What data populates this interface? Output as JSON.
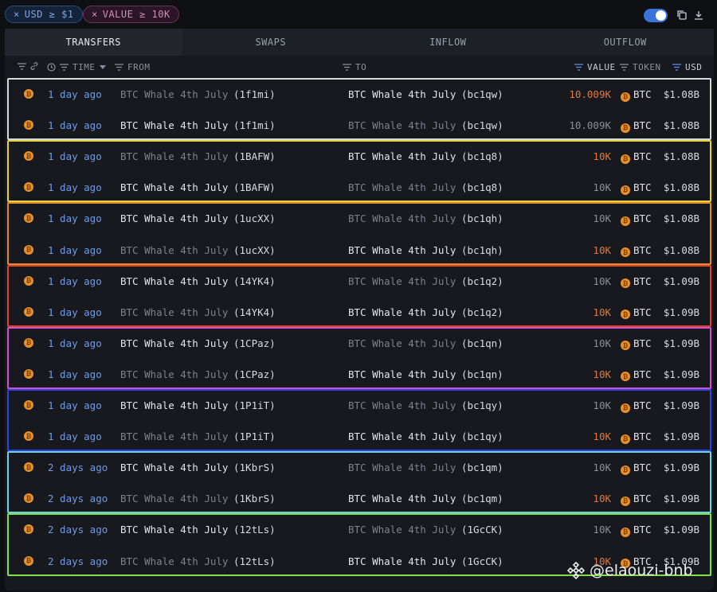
{
  "filters": [
    {
      "label": "USD ≥ $1",
      "remove_glyph": "×"
    },
    {
      "label": "VALUE ≥ 10K",
      "remove_glyph": "×"
    }
  ],
  "toolbar": {
    "toggle_state": "on",
    "icons": [
      "copy-icon",
      "download-icon"
    ]
  },
  "tabs": [
    {
      "label": "TRANSFERS",
      "active": true
    },
    {
      "label": "SWAPS",
      "active": false
    },
    {
      "label": "INFLOW",
      "active": false
    },
    {
      "label": "OUTFLOW",
      "active": false
    }
  ],
  "columns": {
    "time": "TIME",
    "from": "FROM",
    "to": "TO",
    "value": "VALUE",
    "token": "TOKEN",
    "usd": "USD"
  },
  "group_colors": [
    "#d8d8d8",
    "#e6d23a",
    "#e08a2a",
    "#e0452c",
    "#d24fd0",
    "#2a46e0",
    "#6fd3e6",
    "#7fe04a"
  ],
  "rows": [
    {
      "time": "1 day ago",
      "from_name": "BTC Whale 4th July",
      "from_addr": "(1f1mi)",
      "from_dim": true,
      "to_name": "BTC Whale 4th July",
      "to_addr": "(bc1qw)",
      "to_dim": false,
      "value": "10.009K",
      "value_hl": true,
      "token": "BTC",
      "usd": "$1.08B"
    },
    {
      "time": "1 day ago",
      "from_name": "BTC Whale 4th July",
      "from_addr": "(1f1mi)",
      "from_dim": false,
      "to_name": "BTC Whale 4th July",
      "to_addr": "(bc1qw)",
      "to_dim": true,
      "value": "10.009K",
      "value_hl": false,
      "token": "BTC",
      "usd": "$1.08B"
    },
    {
      "time": "1 day ago",
      "from_name": "BTC Whale 4th July",
      "from_addr": "(1BAFW)",
      "from_dim": true,
      "to_name": "BTC Whale 4th July",
      "to_addr": "(bc1q8)",
      "to_dim": false,
      "value": "10K",
      "value_hl": true,
      "token": "BTC",
      "usd": "$1.08B"
    },
    {
      "time": "1 day ago",
      "from_name": "BTC Whale 4th July",
      "from_addr": "(1BAFW)",
      "from_dim": false,
      "to_name": "BTC Whale 4th July",
      "to_addr": "(bc1q8)",
      "to_dim": true,
      "value": "10K",
      "value_hl": false,
      "token": "BTC",
      "usd": "$1.08B"
    },
    {
      "time": "1 day ago",
      "from_name": "BTC Whale 4th July",
      "from_addr": "(1ucXX)",
      "from_dim": false,
      "to_name": "BTC Whale 4th July",
      "to_addr": "(bc1qh)",
      "to_dim": true,
      "value": "10K",
      "value_hl": false,
      "token": "BTC",
      "usd": "$1.08B"
    },
    {
      "time": "1 day ago",
      "from_name": "BTC Whale 4th July",
      "from_addr": "(1ucXX)",
      "from_dim": true,
      "to_name": "BTC Whale 4th July",
      "to_addr": "(bc1qh)",
      "to_dim": false,
      "value": "10K",
      "value_hl": true,
      "token": "BTC",
      "usd": "$1.08B"
    },
    {
      "time": "1 day ago",
      "from_name": "BTC Whale 4th July",
      "from_addr": "(14YK4)",
      "from_dim": false,
      "to_name": "BTC Whale 4th July",
      "to_addr": "(bc1q2)",
      "to_dim": true,
      "value": "10K",
      "value_hl": false,
      "token": "BTC",
      "usd": "$1.09B"
    },
    {
      "time": "1 day ago",
      "from_name": "BTC Whale 4th July",
      "from_addr": "(14YK4)",
      "from_dim": true,
      "to_name": "BTC Whale 4th July",
      "to_addr": "(bc1q2)",
      "to_dim": false,
      "value": "10K",
      "value_hl": true,
      "token": "BTC",
      "usd": "$1.09B"
    },
    {
      "time": "1 day ago",
      "from_name": "BTC Whale 4th July",
      "from_addr": "(1CPaz)",
      "from_dim": false,
      "to_name": "BTC Whale 4th July",
      "to_addr": "(bc1qn)",
      "to_dim": true,
      "value": "10K",
      "value_hl": false,
      "token": "BTC",
      "usd": "$1.09B"
    },
    {
      "time": "1 day ago",
      "from_name": "BTC Whale 4th July",
      "from_addr": "(1CPaz)",
      "from_dim": true,
      "to_name": "BTC Whale 4th July",
      "to_addr": "(bc1qn)",
      "to_dim": false,
      "value": "10K",
      "value_hl": true,
      "token": "BTC",
      "usd": "$1.09B"
    },
    {
      "time": "1 day ago",
      "from_name": "BTC Whale 4th July",
      "from_addr": "(1P1iT)",
      "from_dim": false,
      "to_name": "BTC Whale 4th July",
      "to_addr": "(bc1qy)",
      "to_dim": true,
      "value": "10K",
      "value_hl": false,
      "token": "BTC",
      "usd": "$1.09B"
    },
    {
      "time": "1 day ago",
      "from_name": "BTC Whale 4th July",
      "from_addr": "(1P1iT)",
      "from_dim": true,
      "to_name": "BTC Whale 4th July",
      "to_addr": "(bc1qy)",
      "to_dim": false,
      "value": "10K",
      "value_hl": true,
      "token": "BTC",
      "usd": "$1.09B"
    },
    {
      "time": "2 days ago",
      "from_name": "BTC Whale 4th July",
      "from_addr": "(1KbrS)",
      "from_dim": false,
      "to_name": "BTC Whale 4th July",
      "to_addr": "(bc1qm)",
      "to_dim": true,
      "value": "10K",
      "value_hl": false,
      "token": "BTC",
      "usd": "$1.09B"
    },
    {
      "time": "2 days ago",
      "from_name": "BTC Whale 4th July",
      "from_addr": "(1KbrS)",
      "from_dim": true,
      "to_name": "BTC Whale 4th July",
      "to_addr": "(bc1qm)",
      "to_dim": false,
      "value": "10K",
      "value_hl": true,
      "token": "BTC",
      "usd": "$1.09B"
    },
    {
      "time": "2 days ago",
      "from_name": "BTC Whale 4th July",
      "from_addr": "(12tLs)",
      "from_dim": false,
      "to_name": "BTC Whale 4th July",
      "to_addr": "(1GcCK)",
      "to_dim": true,
      "value": "10K",
      "value_hl": false,
      "token": "BTC",
      "usd": "$1.09B"
    },
    {
      "time": "2 days ago",
      "from_name": "BTC Whale 4th July",
      "from_addr": "(12tLs)",
      "from_dim": true,
      "to_name": "BTC Whale 4th July",
      "to_addr": "(1GcCK)",
      "to_dim": false,
      "value": "10K",
      "value_hl": true,
      "token": "BTC",
      "usd": "$1.09B"
    }
  ],
  "watermark": "@elaouzi-bnb"
}
